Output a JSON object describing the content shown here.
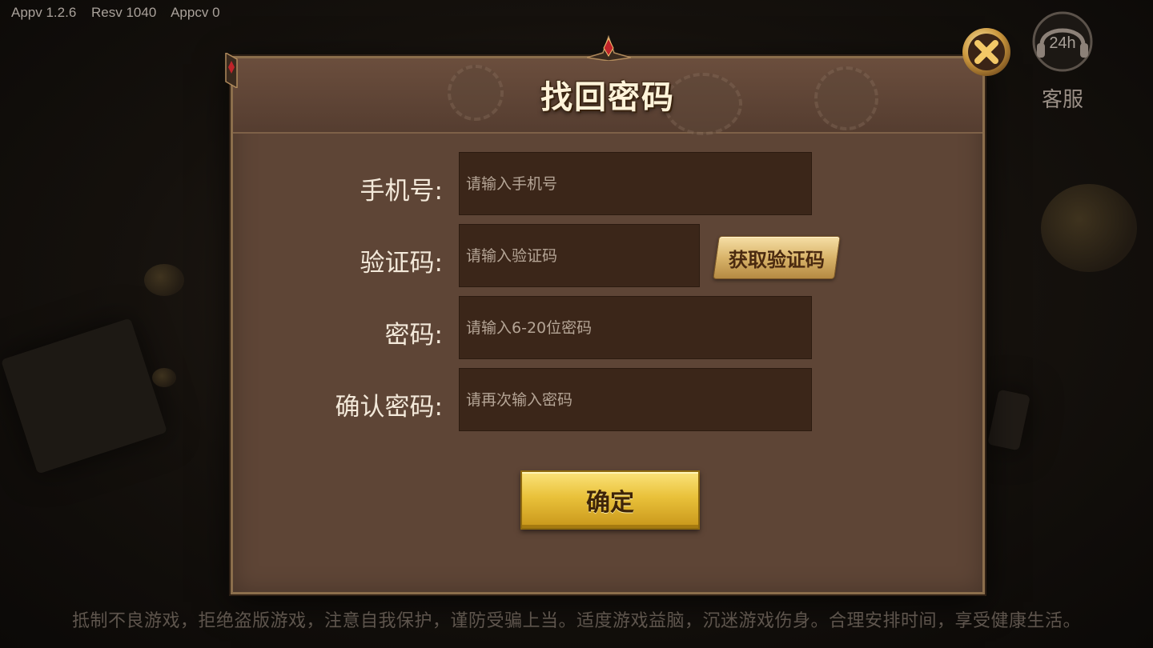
{
  "status_bar": {
    "app_version": "Appv 1.2.6",
    "res_version": "Resv 1040",
    "appc_version": "Appcv 0"
  },
  "dialog": {
    "title": "找回密码",
    "fields": [
      {
        "label": "手机号:",
        "placeholder": "请输入手机号"
      },
      {
        "label": "验证码:",
        "placeholder": "请输入验证码"
      },
      {
        "label": "密码:",
        "placeholder": "请输入6-20位密码"
      },
      {
        "label": "确认密码:",
        "placeholder": "请再次输入密码"
      }
    ],
    "get_code_label": "获取验证码",
    "confirm_label": "确定"
  },
  "service": {
    "badge": "24h",
    "label": "客服"
  },
  "notice": "抵制不良游戏，拒绝盗版游戏，注意自我保护，谨防受骗上当。适度游戏益脑，沉迷游戏伤身。合理安排时间，享受健康生活。",
  "colors": {
    "dialog_bg": "#5e4536",
    "input_bg": "#3b2619",
    "gold": "#e9c13a"
  }
}
